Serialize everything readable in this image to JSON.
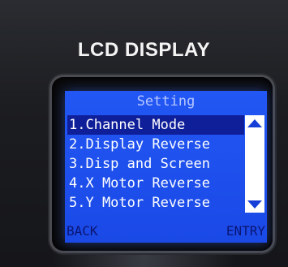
{
  "device": {
    "panel_label": "LCD DISPLAY"
  },
  "screen": {
    "title": "Setting",
    "menu_items": [
      {
        "label": "1.Channel Mode",
        "selected": true
      },
      {
        "label": "2.Display Reverse",
        "selected": false
      },
      {
        "label": "3.Disp and Screen",
        "selected": false
      },
      {
        "label": "4.X Motor Reverse",
        "selected": false
      },
      {
        "label": "5.Y Motor Reverse",
        "selected": false
      }
    ],
    "scrollbar": {
      "up_icon": "triangle-up-icon",
      "down_icon": "triangle-down-icon"
    },
    "softkeys": {
      "left": "BACK",
      "right": "ENTRY"
    }
  },
  "colors": {
    "screen_background": "#2257f4",
    "selection_highlight": "#0f1f9a",
    "softkey_text": "#0b1572"
  }
}
